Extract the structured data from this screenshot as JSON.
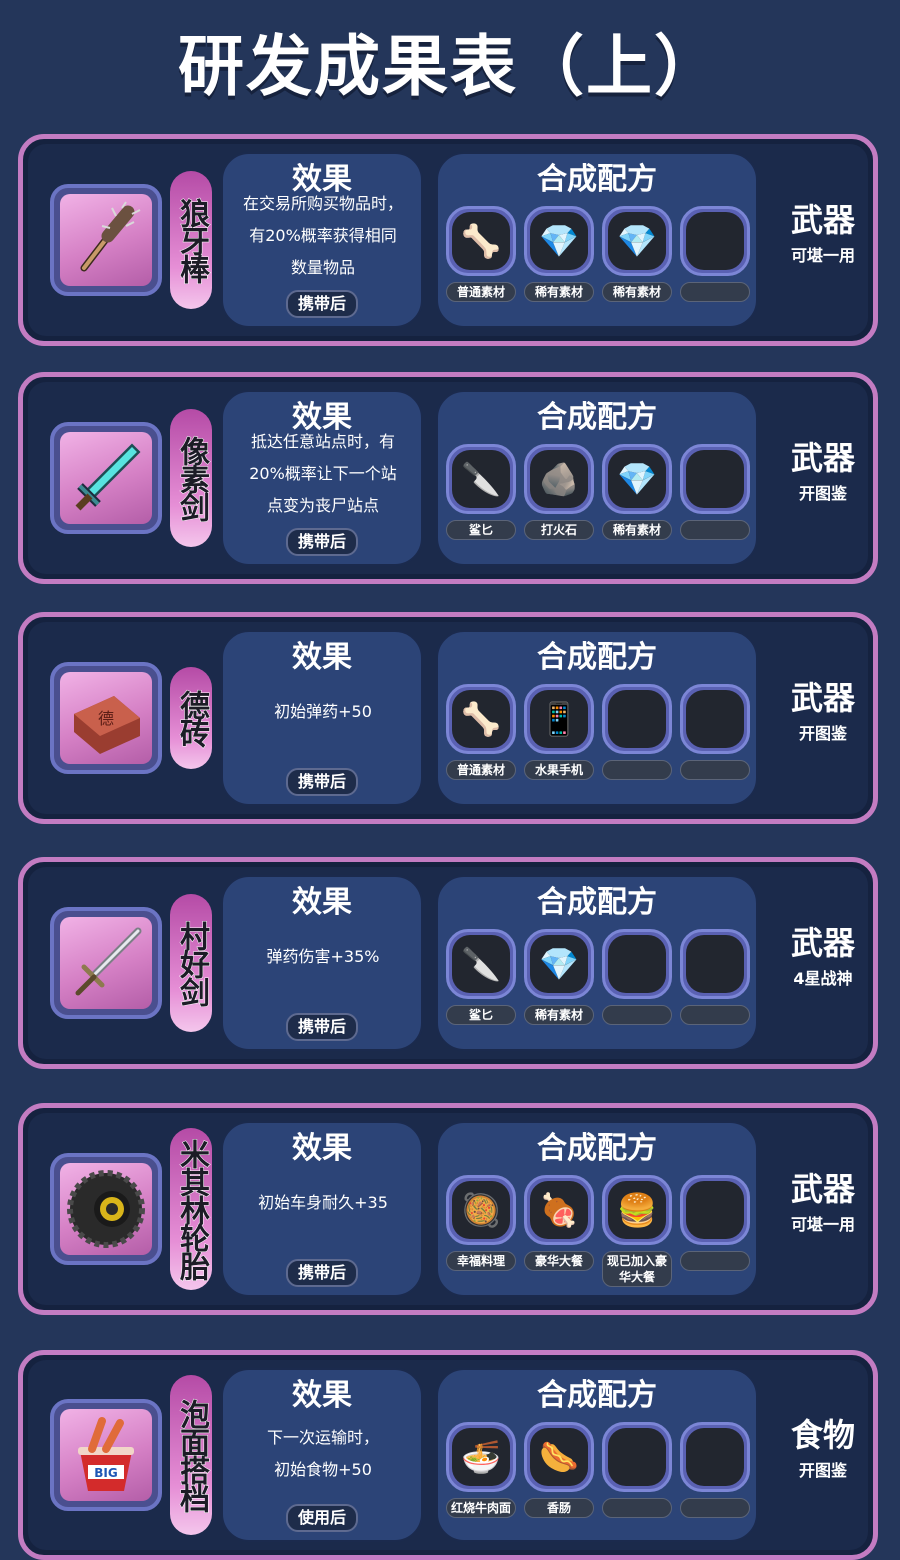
{
  "title": "研发成果表（上）",
  "labels": {
    "effect_head": "效果",
    "recipe_head": "合成配方"
  },
  "cards": [
    {
      "name": "狼牙棒",
      "item_icon": "spiked-club-icon",
      "effect_lines": [
        "在交易所购买物品时，",
        "有20%概率获得相同",
        "数量物品"
      ],
      "condition": "携带后",
      "ingredients": [
        {
          "label": "普通素材",
          "icon": "horn-material-icon",
          "glyph": "🦴"
        },
        {
          "label": "稀有素材",
          "icon": "rare-crystal-icon",
          "glyph": "💎"
        },
        {
          "label": "稀有素材",
          "icon": "rare-crystal-icon",
          "glyph": "💎"
        },
        {
          "label": "",
          "icon": "empty-slot",
          "glyph": ""
        }
      ],
      "type": "武器",
      "subtype": "可堪一用"
    },
    {
      "name": "像素剑",
      "item_icon": "pixel-sword-icon",
      "effect_lines": [
        "抵达任意站点时，有",
        "20%概率让下一个站",
        "点变为丧尸站点"
      ],
      "condition": "携带后",
      "ingredients": [
        {
          "label": "鲨匕",
          "icon": "shark-dagger-icon",
          "glyph": "🔪"
        },
        {
          "label": "打火石",
          "icon": "flint-icon",
          "glyph": "🪨"
        },
        {
          "label": "稀有素材",
          "icon": "rare-crystal-icon",
          "glyph": "💎"
        },
        {
          "label": "",
          "icon": "empty-slot",
          "glyph": ""
        }
      ],
      "type": "武器",
      "subtype": "开图鉴"
    },
    {
      "name": "德砖",
      "item_icon": "brick-icon",
      "effect_lines": [
        "初始弹药+50"
      ],
      "condition": "携带后",
      "ingredients": [
        {
          "label": "普通素材",
          "icon": "horn-material-icon",
          "glyph": "🦴"
        },
        {
          "label": "水果手机",
          "icon": "phone-icon",
          "glyph": "📱"
        },
        {
          "label": "",
          "icon": "empty-slot",
          "glyph": ""
        },
        {
          "label": "",
          "icon": "empty-slot",
          "glyph": ""
        }
      ],
      "type": "武器",
      "subtype": "开图鉴"
    },
    {
      "name": "村好剑",
      "item_icon": "long-sword-icon",
      "effect_lines": [
        "弹药伤害+35%"
      ],
      "condition": "携带后",
      "ingredients": [
        {
          "label": "鲨匕",
          "icon": "shark-dagger-icon",
          "glyph": "🔪"
        },
        {
          "label": "稀有素材",
          "icon": "rare-crystal-icon",
          "glyph": "💎"
        },
        {
          "label": "",
          "icon": "empty-slot",
          "glyph": ""
        },
        {
          "label": "",
          "icon": "empty-slot",
          "glyph": ""
        }
      ],
      "type": "武器",
      "subtype": "4星战神"
    },
    {
      "name": "米其林轮胎",
      "item_icon": "tire-icon",
      "effect_lines": [
        "初始车身耐久+35"
      ],
      "condition": "携带后",
      "ingredients": [
        {
          "label": "幸福料理",
          "icon": "heart-dish-icon",
          "glyph": "🥘"
        },
        {
          "label": "豪华大餐",
          "icon": "feast-icon",
          "glyph": "🍖"
        },
        {
          "label": "现已加入豪华大餐",
          "icon": "burger-meal-icon",
          "glyph": "🍔"
        },
        {
          "label": "",
          "icon": "empty-slot",
          "glyph": ""
        }
      ],
      "type": "武器",
      "subtype": "可堪一用"
    },
    {
      "name": "泡面搭档",
      "item_icon": "noodle-cup-icon",
      "effect_lines": [
        "下一次运输时，",
        "初始食物+50"
      ],
      "condition": "使用后",
      "ingredients": [
        {
          "label": "红烧牛肉面",
          "icon": "noodle-cup-icon",
          "glyph": "🍜"
        },
        {
          "label": "香肠",
          "icon": "sausage-icon",
          "glyph": "🌭"
        },
        {
          "label": "",
          "icon": "empty-slot",
          "glyph": ""
        },
        {
          "label": "",
          "icon": "empty-slot",
          "glyph": ""
        }
      ],
      "type": "食物",
      "subtype": "开图鉴"
    }
  ]
}
